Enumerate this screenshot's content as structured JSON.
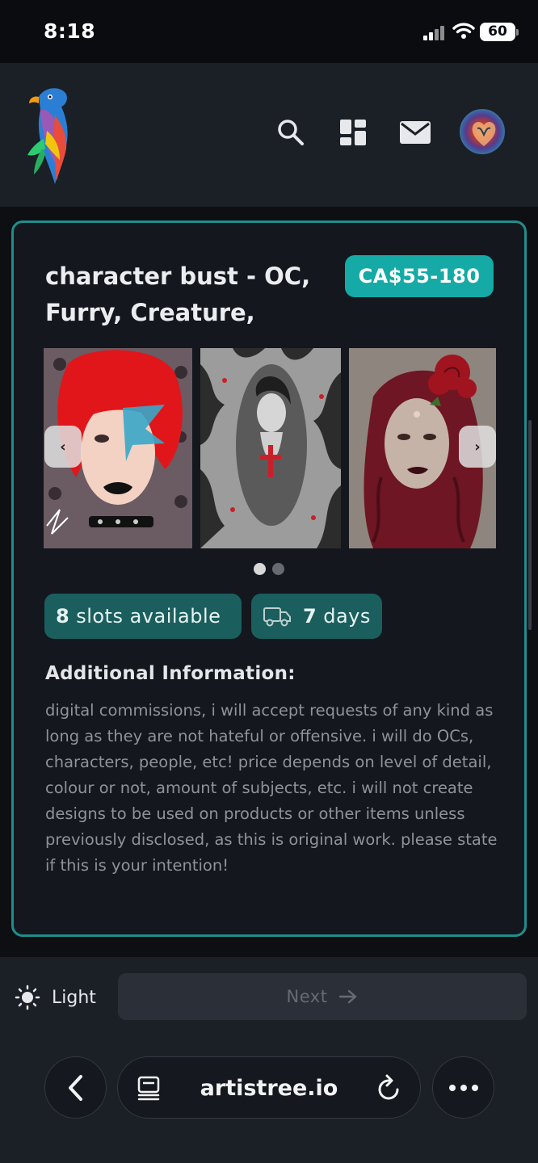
{
  "status_bar": {
    "time": "8:18",
    "battery": "60"
  },
  "header": {
    "logo_icon": "parrot-logo-icon",
    "icons": [
      "search-icon",
      "dashboard-icon",
      "mail-icon"
    ]
  },
  "listing": {
    "title": "character bust - OC, Furry, Creature,",
    "price": "CA$55-180",
    "gallery": {
      "images": [
        "red-hair-glam-portrait",
        "monochrome-figure-with-cross",
        "red-curly-hair-rose-portrait"
      ],
      "prev_icon": "chevron-left-icon",
      "next_icon": "chevron-right-icon",
      "page_count": 2,
      "active_page": 1
    },
    "slots": {
      "count": "8",
      "label": "slots available"
    },
    "delivery": {
      "icon": "truck-icon",
      "count": "7",
      "label": "days"
    },
    "info_heading": "Additional Information:",
    "info_text": "digital commissions, i will accept requests of any kind as long as they are not hateful or offensive. i will do OCs, characters, people, etc! price depends on level of detail, colour or not, amount of subjects, etc. i will not create designs to be used on products or other items unless previously disclosed, as this is original work. please state if this is your intention!"
  },
  "footer": {
    "theme_label": "Light",
    "theme_icon": "sun-icon",
    "next_label": "Next",
    "next_icon": "arrow-right-icon"
  },
  "browser": {
    "url": "artistree.io",
    "back_icon": "chevron-left-icon",
    "tabs_icon": "page-layout-icon",
    "reload_icon": "reload-icon",
    "more_icon": "ellipsis-icon"
  },
  "colors": {
    "accent": "#16aaa6",
    "card_border": "#1f8e8c",
    "pill_bg": "#1a5f5d",
    "background": "#14171d"
  }
}
